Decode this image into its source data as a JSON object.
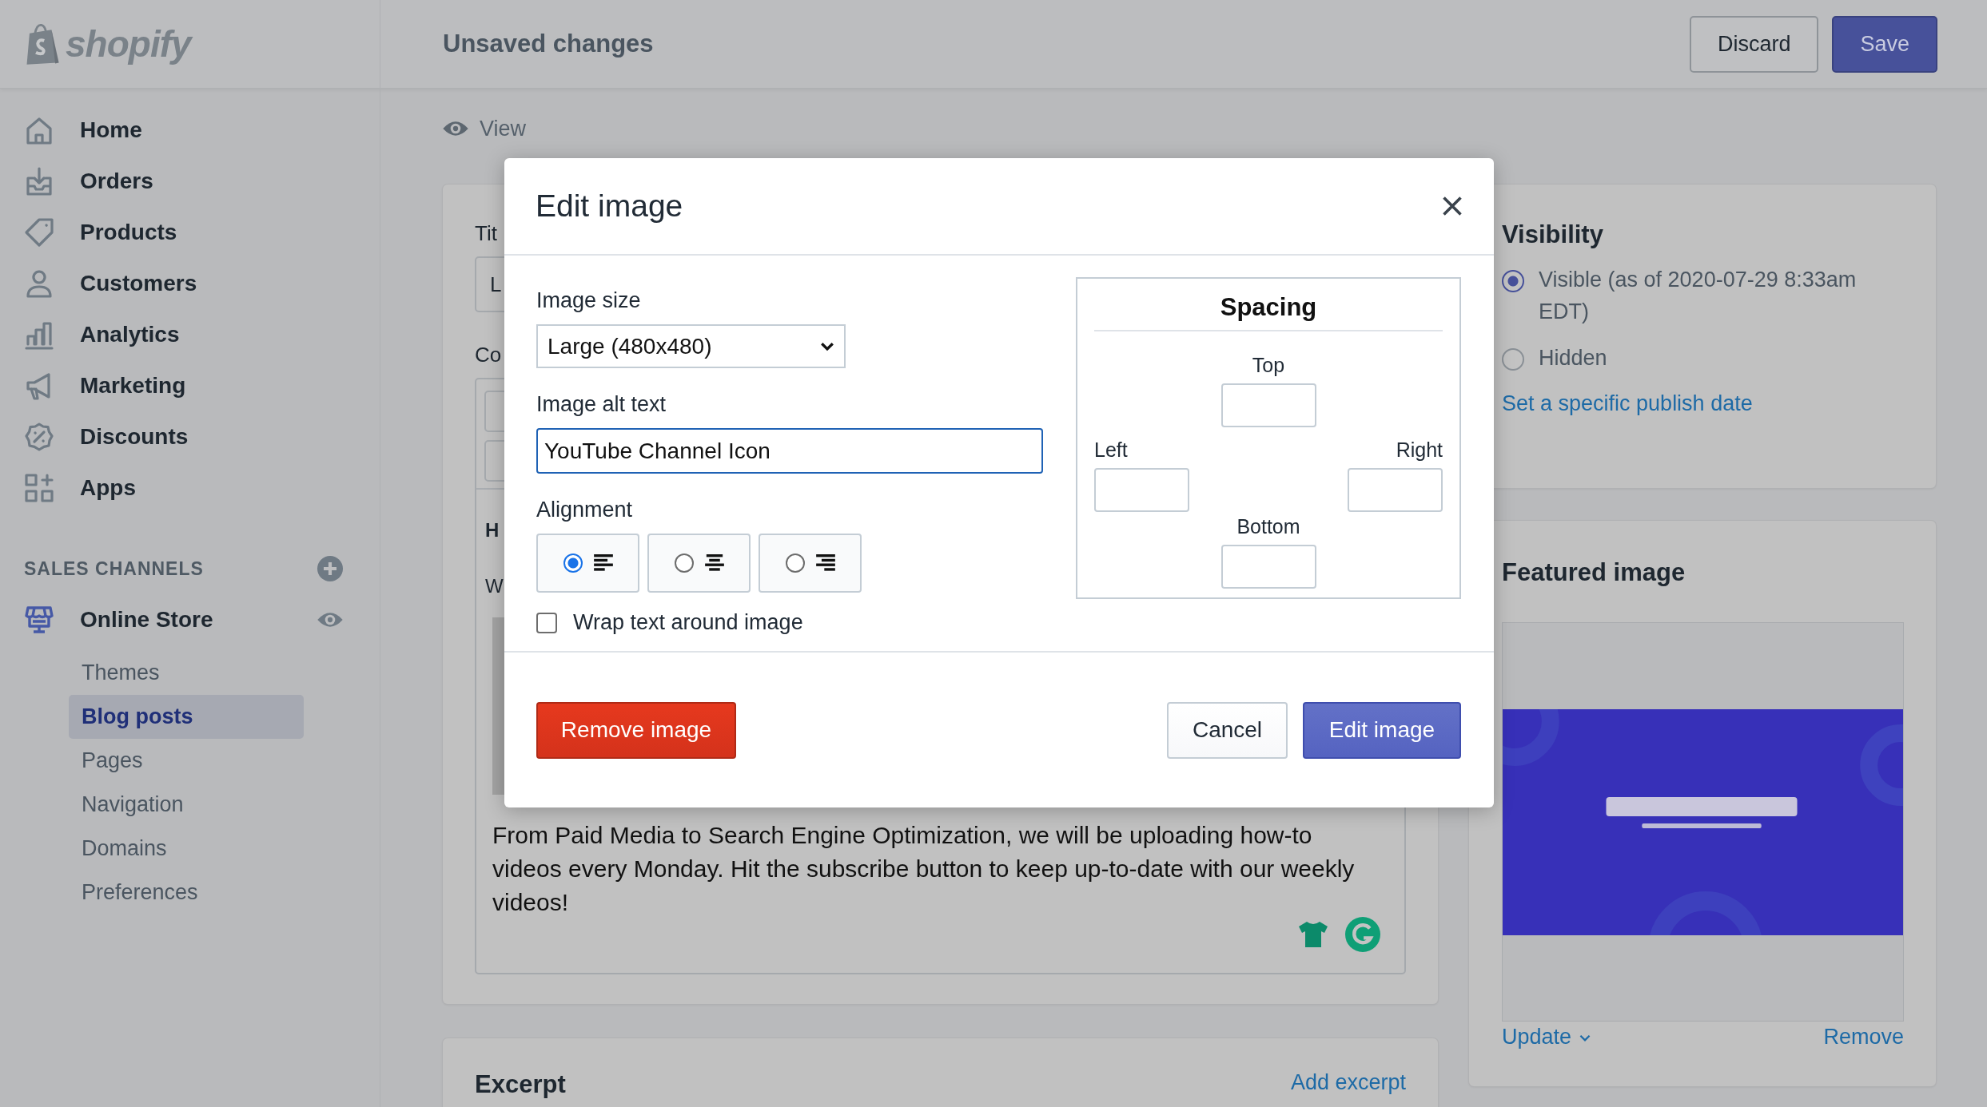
{
  "topbar": {
    "brand": "shopify",
    "title": "Unsaved changes",
    "buttons": [
      {
        "label": "Discard",
        "kind": "secondary"
      },
      {
        "label": "Save",
        "kind": "primary"
      }
    ]
  },
  "sidebar": {
    "items": [
      {
        "label": "Home",
        "selected": false
      },
      {
        "label": "Orders",
        "selected": false
      },
      {
        "label": "Products",
        "selected": false
      },
      {
        "label": "Customers",
        "selected": false
      },
      {
        "label": "Analytics",
        "selected": false
      },
      {
        "label": "Marketing",
        "selected": false
      },
      {
        "label": "Discounts",
        "selected": false
      },
      {
        "label": "Apps",
        "selected": false
      }
    ],
    "section_heading": "SALES CHANNELS",
    "channel": {
      "label": "Online Store",
      "children": [
        {
          "label": "Themes",
          "selected": false
        },
        {
          "label": "Blog posts",
          "selected": true
        },
        {
          "label": "Pages",
          "selected": false
        },
        {
          "label": "Navigation",
          "selected": false
        },
        {
          "label": "Domains",
          "selected": false
        },
        {
          "label": "Preferences",
          "selected": false
        }
      ]
    }
  },
  "view_link": "View",
  "post_card": {
    "title_label": "Tit",
    "title_value": "L",
    "content_label": "Co",
    "editor_lines": [
      "H",
      "W"
    ],
    "body": "From Paid Media to Search Engine Optimization, we will be uploading how-to videos every Monday. Hit the subscribe button to keep up-to-date with our weekly videos!"
  },
  "excerpt_card": {
    "title": "Excerpt",
    "action": "Add excerpt"
  },
  "visibility_card": {
    "title": "Visibility",
    "options": [
      {
        "label": "Visible (as of 2020-07-29 8:33am EDT)",
        "selected": true
      },
      {
        "label": "Hidden",
        "selected": false
      }
    ],
    "link": "Set a specific publish date"
  },
  "featured_image_card": {
    "title": "Featured image",
    "image": {
      "kind": "picture"
    },
    "actions": [
      "Update",
      "Remove"
    ]
  },
  "modal": {
    "title": "Edit image",
    "image_size": {
      "label": "Image size",
      "value": "Large (480x480)"
    },
    "alt_text": {
      "label": "Image alt text",
      "value": "YouTube Channel Icon"
    },
    "alignment": {
      "label": "Alignment",
      "options": [
        {
          "selected": true
        },
        {
          "selected": false
        },
        {
          "selected": false
        }
      ]
    },
    "wrap": {
      "label": "Wrap text around image",
      "checked": false
    },
    "spacing": {
      "title": "Spacing",
      "fields": [
        {
          "label": "Top"
        },
        {
          "label": "Left"
        },
        {
          "label": "Right"
        },
        {
          "label": "Bottom"
        }
      ]
    },
    "buttons": [
      {
        "label": "Remove image",
        "kind": "destructive"
      },
      {
        "label": "Cancel",
        "kind": "secondary"
      },
      {
        "label": "Edit image",
        "kind": "primary"
      }
    ]
  }
}
